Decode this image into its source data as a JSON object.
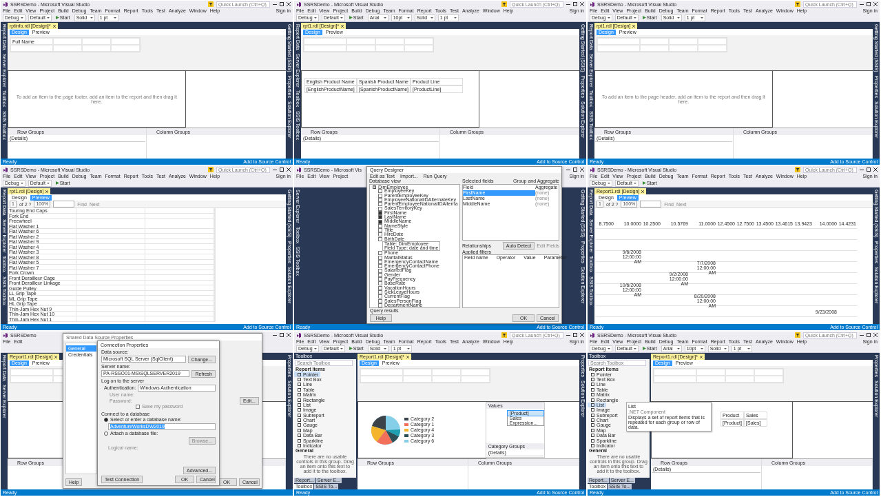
{
  "tiles": [
    {
      "title": "SSRSDemo - Microsoft Visual Studio",
      "quick_launch": {
        "placeholder": "Quick Launch (Ctrl+Q)"
      },
      "sign_in": "Sign in",
      "menu": [
        "File",
        "Edit",
        "View",
        "Project",
        "Build",
        "Debug",
        "Team",
        "Format",
        "Report",
        "Tools",
        "Test",
        "Analyze",
        "Window",
        "Help"
      ],
      "toolbar": [
        {
          "label": "Debug",
          "kind": "combo"
        },
        {
          "label": "Default",
          "kind": "combo"
        },
        {
          "label": "Start",
          "kind": "run"
        },
        {
          "label": "Solid",
          "kind": "combo"
        },
        {
          "label": "1 pt",
          "kind": "combo"
        }
      ],
      "left_tabs": [
        "Report Data",
        "Server Explorer",
        "Toolbox",
        "SSIS Toolbox"
      ],
      "right_tabs": [
        "Getting Started (SSIS)",
        "Properties",
        "Solution Explorer"
      ],
      "document_tab": "rptinfo.rdl [Design]*",
      "view_tabs": [
        {
          "label": "Design",
          "selected": true
        },
        {
          "label": "Preview",
          "selected": false
        }
      ],
      "content": {
        "kind": "design",
        "header_text": "Full Name",
        "body": {
          "kind": "hint",
          "text": "To add an item to the page footer, add an item to the report and then drag it here."
        },
        "groups": {
          "row": "Row Groups",
          "column": "Column Groups",
          "details": "(Details)"
        }
      },
      "status": "Ready",
      "source_control": "Add to Source Control"
    },
    {
      "title": "SSRSDemo - Microsoft Visual Studio",
      "quick_launch": {
        "placeholder": "Quick Launch (Ctrl+Q)"
      },
      "sign_in": "Sign in",
      "menu": [
        "File",
        "Edit",
        "View",
        "Project",
        "Build",
        "Debug",
        "Team",
        "Format",
        "Report",
        "Tools",
        "Test",
        "Analyze",
        "Window",
        "Help"
      ],
      "toolbar": [
        {
          "label": "Debug",
          "kind": "combo"
        },
        {
          "label": "Default",
          "kind": "combo"
        },
        {
          "label": "Start",
          "kind": "run"
        },
        {
          "label": "Arial",
          "kind": "combo"
        },
        {
          "label": "10pt",
          "kind": "combo"
        },
        {
          "label": "Solid",
          "kind": "combo"
        },
        {
          "label": "1 pt",
          "kind": "combo"
        }
      ],
      "left_tabs": [
        "Report Data",
        "Server Explorer",
        "Toolbox",
        "SSIS Toolbox"
      ],
      "right_tabs": [
        "Getting Started (SSIS)",
        "Properties",
        "Solution Explorer"
      ],
      "document_tab": "rpt1.rdl [Design]*",
      "view_tabs": [
        {
          "label": "Design",
          "selected": true
        },
        {
          "label": "Preview",
          "selected": false
        }
      ],
      "content": {
        "kind": "design",
        "body": {
          "kind": "table",
          "columns": [
            "English Product Name",
            "Spanish Product Name",
            "Product Line"
          ],
          "rows": [
            [
              "[EnglishProductName]",
              "[SpanishProductName]",
              "[ProductLine]"
            ]
          ]
        },
        "groups": {
          "row": "Row Groups",
          "column": "Column Groups",
          "details": "(Details)"
        }
      },
      "status": "Ready",
      "source_control": "Add to Source Control"
    },
    {
      "title": "SSRSDemo - Microsoft Visual Studio",
      "quick_launch": {
        "placeholder": "Quick Launch (Ctrl+Q)"
      },
      "sign_in": "Sign in",
      "menu": [
        "File",
        "Edit",
        "View",
        "Project",
        "Build",
        "Debug",
        "Team",
        "Format",
        "Report",
        "Tools",
        "Test",
        "Analyze",
        "Window",
        "Help"
      ],
      "toolbar": [
        {
          "label": "Debug",
          "kind": "combo"
        },
        {
          "label": "Default",
          "kind": "combo"
        },
        {
          "label": "Start",
          "kind": "run"
        },
        {
          "label": "Solid",
          "kind": "combo"
        },
        {
          "label": "1 pt",
          "kind": "combo"
        }
      ],
      "left_tabs": [
        "Report Data",
        "Server Explorer",
        "Toolbox",
        "SSIS Toolbox"
      ],
      "right_tabs": [
        "Getting Started (SSIS)",
        "Properties",
        "Solution Explorer"
      ],
      "document_tab": "rpt1.rdl [Design]",
      "view_tabs": [
        {
          "label": "Design",
          "selected": true
        },
        {
          "label": "Preview",
          "selected": false
        }
      ],
      "content": {
        "kind": "design",
        "body": {
          "kind": "hint",
          "text": "To add an item to the page header, add an item to the report and then drag it here."
        },
        "groups": {
          "row": "Row Groups",
          "column": "Column Groups",
          "details": "(Details)"
        }
      },
      "status": "Ready",
      "source_control": "Add to Source Control"
    },
    {
      "title": "SSRSDemo - Microsoft Visual Studio",
      "quick_launch": {
        "placeholder": "Quick Launch (Ctrl+Q)"
      },
      "sign_in": "Sign in",
      "menu": [
        "File",
        "Edit",
        "View",
        "Project",
        "Build",
        "Debug",
        "Team",
        "Format",
        "Report",
        "Tools",
        "Test",
        "Analyze",
        "Window",
        "Help"
      ],
      "toolbar": [
        {
          "label": "Debug",
          "kind": "combo"
        },
        {
          "label": "Default",
          "kind": "combo"
        },
        {
          "label": "Start",
          "kind": "run"
        }
      ],
      "left_tabs": [
        "Report Data",
        "Server Explorer",
        "Toolbox",
        "SSIS Toolbox"
      ],
      "right_tabs": [
        "Getting Started (SSIS)",
        "Properties",
        "Solution Explorer"
      ],
      "document_tab": "rpt1.rdl [Design]",
      "view_tabs": [
        {
          "label": "Design",
          "selected": false
        },
        {
          "label": "Preview",
          "selected": true
        }
      ],
      "content": {
        "kind": "list",
        "toolbar": {
          "page": "1",
          "of": "of 2 ?",
          "zoom": "100%",
          "find": "Find",
          "next": "Next"
        },
        "rows": [
          "Touring End Caps",
          "Fork End",
          "Freewheel",
          "Flat Washer 1",
          "Flat Washer 6",
          "Flat Washer 2",
          "Flat Washer 9",
          "Flat Washer 4",
          "Flat Washer 3",
          "Flat Washer 8",
          "Flat Washer 5",
          "Flat Washer 7",
          "Fork Crown",
          "Front Derailleur Cage",
          "Front Derailleur Linkage",
          "Guide Pulley",
          "LL Grip Tape",
          "ML Grip Tape",
          "HL Grip Tape",
          "Thin-Jam Hex Nut 9",
          "Thin-Jam Hex Nut 10",
          "Thin-Jam Hex Nut 1"
        ]
      },
      "status": "Ready",
      "source_control": "Add to Source Control"
    },
    {
      "title": "SSRSDemo - Microsoft Vis",
      "sign_in": "Sign in",
      "menu": [
        "File",
        "Edit",
        "View",
        "Project"
      ],
      "left_tabs": [
        "Server Explorer",
        "Toolbox",
        "SSIS Toolbox"
      ],
      "right_tabs": [
        "Getting Started (SSIS)",
        "Properties",
        "Solution Explorer"
      ],
      "content": {
        "kind": "blank"
      },
      "query_designer": {
        "title": "Query Designer",
        "actions": [
          "Edit as Text",
          "Import...",
          "Run Query"
        ],
        "database_view": "Database view",
        "table": "DimEmployee",
        "fields": [
          {
            "label": "EmployeeKey",
            "checked": false
          },
          {
            "label": "ParentEmployeeKey",
            "checked": false
          },
          {
            "label": "EmployeeNationalIDAlternateKey",
            "checked": false
          },
          {
            "label": "ParentEmployeeNationalIDAlterna",
            "checked": false
          },
          {
            "label": "SalesTerritoryKey",
            "checked": false
          },
          {
            "label": "FirstName",
            "checked": true
          },
          {
            "label": "LastName",
            "checked": true
          },
          {
            "label": "MiddleName",
            "checked": true
          },
          {
            "label": "NameStyle",
            "checked": false
          },
          {
            "label": "Title",
            "checked": false
          },
          {
            "label": "HireDate",
            "checked": false
          },
          {
            "label": "BirthDate",
            "checked": false
          },
          {
            "label": "Phone",
            "checked": false
          },
          {
            "label": "MaritalStatus",
            "checked": false
          },
          {
            "label": "EmergencyContactName",
            "checked": false
          },
          {
            "label": "EmergencyContactPhone",
            "checked": false
          },
          {
            "label": "SalariedFlag",
            "checked": false
          },
          {
            "label": "Gender",
            "checked": false
          },
          {
            "label": "PayFrequency",
            "checked": false
          },
          {
            "label": "BaseRate",
            "checked": false
          },
          {
            "label": "VacationHours",
            "checked": false
          },
          {
            "label": "SickLeaveHours",
            "checked": false
          },
          {
            "label": "CurrentFlag",
            "checked": false
          },
          {
            "label": "SalesPersonFlag",
            "checked": false
          },
          {
            "label": "DepartmentName",
            "checked": false
          }
        ],
        "tooltip": [
          "Table: DimEmployee",
          "Field Type: date and time"
        ],
        "selected_fields": "Selected fields",
        "group_aggregate": "Group and Aggregate",
        "field_columns": [
          "Field",
          "Aggregate"
        ],
        "selected": [
          {
            "field": "FirstName",
            "aggregate": "(none)",
            "selected": true
          },
          {
            "field": "LastName",
            "aggregate": "(none)",
            "selected": false
          },
          {
            "field": "MiddleName",
            "aggregate": "(none)",
            "selected": false
          }
        ],
        "relationships": "Relationships",
        "auto_detect": "Auto Detect",
        "edit_fields": "Edit Fields",
        "applied_filters": "Applied filters",
        "filter_columns": [
          "Field name",
          "Operator",
          "Value",
          "Parameter"
        ],
        "query_results": "Query results",
        "buttons": [
          "Help",
          "OK",
          "Cancel"
        ]
      },
      "status": "Ready",
      "source_control": "Add to Source Control"
    },
    {
      "title": "SSRSDemo - Microsoft Visual Studio",
      "quick_launch": {
        "placeholder": "Quick Launch (Ctrl+Q)"
      },
      "sign_in": "Sign in",
      "menu": [
        "File",
        "Edit",
        "View",
        "Project",
        "Build",
        "Debug",
        "Team",
        "Format",
        "Report",
        "Tools",
        "Test",
        "Analyze",
        "Window",
        "Help"
      ],
      "toolbar": [
        {
          "label": "Debug",
          "kind": "combo"
        },
        {
          "label": "Default",
          "kind": "combo"
        },
        {
          "label": "Start",
          "kind": "run"
        }
      ],
      "left_tabs": [
        "Report Data",
        "Server Explorer",
        "Toolbox",
        "SSIS Toolbox"
      ],
      "right_tabs": [
        "Getting Started (SSIS)",
        "Properties",
        "Solution Explorer"
      ],
      "document_tab": "Report1.rdl [Design]",
      "view_tabs": [
        {
          "label": "Design",
          "selected": false
        },
        {
          "label": "Preview",
          "selected": true
        }
      ],
      "content": {
        "kind": "matrix",
        "toolbar": {
          "page": "1",
          "of": "of 2 ?",
          "zoom": "100%",
          "find": "Find",
          "next": "Next"
        },
        "columns": [
          "8.7500",
          "10.0000",
          "10.2500",
          "10.5769",
          "11.0000",
          "12.4500",
          "12.7500",
          "13.4500",
          "13.4615",
          "13.9423",
          "14.0000",
          "14.4231"
        ],
        "rows": [
          [
            null,
            null,
            null,
            null,
            null,
            null,
            null,
            null,
            null,
            null,
            null,
            null
          ],
          [
            null,
            null,
            null,
            null,
            null,
            null,
            null,
            null,
            null,
            null,
            null,
            null
          ],
          [
            null,
            "9/6/2008 12:00:00 AM",
            null,
            null,
            null,
            null,
            null,
            null,
            null,
            null,
            null,
            null
          ],
          [
            null,
            null,
            null,
            null,
            "7/7/2008 12:00:00 AM",
            null,
            null,
            null,
            null,
            null,
            null,
            null
          ],
          [
            null,
            null,
            null,
            "9/2/2008 12:00:00 AM",
            null,
            null,
            null,
            null,
            null,
            null,
            null,
            null
          ],
          [
            null,
            "10/6/2008 12:00:00 AM",
            null,
            null,
            null,
            null,
            null,
            null,
            null,
            null,
            null,
            null
          ],
          [
            null,
            null,
            null,
            null,
            "8/20/2008 12:00:00 AM",
            null,
            null,
            null,
            null,
            null,
            null,
            null
          ],
          [
            null,
            null,
            null,
            null,
            null,
            null,
            null,
            null,
            null,
            null,
            "9/23/2008",
            null
          ]
        ]
      },
      "status": "Ready",
      "source_control": "Add to Source Control"
    },
    {
      "title": "SSRSDemo",
      "menu": [
        "File",
        "Edit"
      ],
      "left_tabs": [
        "Report Data",
        "Server Explorer"
      ],
      "right_tabs": [
        "Properties",
        "Solution Explorer"
      ],
      "document_tab": "Report1.rdl [Design]",
      "view_tabs": [
        {
          "label": "Design",
          "selected": true
        },
        {
          "label": "Preview",
          "selected": false
        }
      ],
      "content": {
        "kind": "design",
        "body": {
          "kind": "none"
        },
        "groups": {
          "row": "Row Groups"
        }
      },
      "connection": {
        "behind": {
          "title": "Shared Data Source Properties",
          "nav": [
            {
              "label": "General",
              "selected": true
            },
            {
              "label": "Credentials",
              "selected": false
            }
          ],
          "help": "Help",
          "edit": "Edit...",
          "ok": "OK",
          "cancel": "Cancel"
        },
        "title": "Connection Properties",
        "data_source_label": "Data source:",
        "data_source": "Microsoft SQL Server (SqlClient)",
        "change": "Change...",
        "server_label": "Server name:",
        "server": "PA-RSSO01-MS\\SQLSERVER2019",
        "refresh": "Refresh",
        "logon": "Log on to the server",
        "auth_label": "Authentication:",
        "auth": "Windows Authentication",
        "user_label": "User name:",
        "password_label": "Password:",
        "save_password": {
          "label": "Save my password",
          "checked": false
        },
        "connect": "Connect to a database",
        "options": [
          {
            "label": "Select or enter a database name:",
            "selected": true
          },
          {
            "label": "Attach a database file:",
            "selected": false
          }
        ],
        "database": "AdventureWorksDW2019",
        "browse": "Browse...",
        "logical": "Logical name:",
        "advanced": "Advanced...",
        "test": "Test Connection",
        "ok": "OK",
        "cancel": "Cancel"
      },
      "status": "Ready"
    },
    {
      "title": "SSRSDemo - Microsoft Visual Studio",
      "quick_launch": {
        "placeholder": "Quick Launch (Ctrl+Q)"
      },
      "sign_in": "Sign in",
      "menu": [
        "File",
        "Edit",
        "View",
        "Project",
        "Build",
        "Debug",
        "Team",
        "Format",
        "Report",
        "Tools",
        "Test",
        "Analyze",
        "Window",
        "Help"
      ],
      "toolbar": [
        {
          "label": "Debug",
          "kind": "combo"
        },
        {
          "label": "Default",
          "kind": "combo"
        },
        {
          "label": "Start",
          "kind": "run"
        },
        {
          "label": "Solid",
          "kind": "combo"
        },
        {
          "label": "1 pt",
          "kind": "combo"
        }
      ],
      "toolbox": {
        "title": "Toolbox",
        "search": {
          "placeholder": "Search Toolbox"
        },
        "group": "Report Items",
        "items": [
          {
            "label": "Pointer",
            "selected": true
          },
          {
            "label": "Text Box",
            "selected": false
          },
          {
            "label": "Line",
            "selected": false
          },
          {
            "label": "Table",
            "selected": false
          },
          {
            "label": "Matrix",
            "selected": false
          },
          {
            "label": "Rectangle",
            "selected": false
          },
          {
            "label": "List",
            "selected": false
          },
          {
            "label": "Image",
            "selected": false
          },
          {
            "label": "Subreport",
            "selected": false
          },
          {
            "label": "Chart",
            "selected": false
          },
          {
            "label": "Gauge",
            "selected": false
          },
          {
            "label": "Map",
            "selected": false
          },
          {
            "label": "Data Bar",
            "selected": false
          },
          {
            "label": "Sparkline",
            "selected": false
          },
          {
            "label": "Indicator",
            "selected": false
          }
        ],
        "general": "General",
        "empty": "There are no usable controls in this group. Drag an item onto this text to add it to the toolbox.",
        "bottom_tabs": [
          {
            "label": "Report...",
            "selected": false
          },
          {
            "label": "Server E...",
            "selected": false
          },
          {
            "label": "Toolbox",
            "selected": true
          },
          {
            "label": "SSIS To...",
            "selected": false
          }
        ]
      },
      "right_tabs": [
        "Properties",
        "Solution Explorer"
      ],
      "document_tab": "Report1.rdl [Design]*",
      "view_tabs": [
        {
          "label": "Design",
          "selected": true
        },
        {
          "label": "Preview",
          "selected": false
        }
      ],
      "content": {
        "kind": "design",
        "body": {
          "kind": "chart",
          "legend": [
            {
              "label": "Category 2",
              "color": "#3d4449"
            },
            {
              "label": "Category 1",
              "color": "#f2705a"
            },
            {
              "label": "Category 4",
              "color": "#f4b42c"
            },
            {
              "label": "Category 3",
              "color": "#2d4f55"
            },
            {
              "label": "Category 6",
              "color": "#86cfe8"
            }
          ],
          "values_title": "Values",
          "menu": [
            {
              "label": "[Product]",
              "selected": true
            },
            {
              "label": "Sales",
              "selected": false
            },
            {
              "label": "Expression...",
              "selected": false
            }
          ],
          "category_groups": "Category Groups",
          "category_details": "(Details)"
        },
        "groups": {
          "row": "Row Groups",
          "column": "Column Groups"
        }
      },
      "status": "Ready",
      "source_control": "Add to Source Control"
    },
    {
      "title": "SSRSDemo - Microsoft Visual Studio",
      "quick_launch": {
        "placeholder": "Quick Launch (Ctrl+Q)"
      },
      "sign_in": "Sign in",
      "menu": [
        "File",
        "Edit",
        "View",
        "Project",
        "Build",
        "Debug",
        "Team",
        "Format",
        "Report",
        "Tools",
        "Test",
        "Analyze",
        "Window",
        "Help"
      ],
      "toolbar": [
        {
          "label": "Debug",
          "kind": "combo"
        },
        {
          "label": "Default",
          "kind": "combo"
        },
        {
          "label": "Start",
          "kind": "run"
        },
        {
          "label": "Arial",
          "kind": "combo"
        },
        {
          "label": "10pt",
          "kind": "combo"
        },
        {
          "label": "Solid",
          "kind": "combo"
        },
        {
          "label": "1 pt",
          "kind": "combo"
        }
      ],
      "toolbox": {
        "title": "Toolbox",
        "search": {
          "placeholder": "Search Toolbox"
        },
        "group": "Report Items",
        "items": [
          {
            "label": "Pointer",
            "selected": false
          },
          {
            "label": "Text Box",
            "selected": false
          },
          {
            "label": "Line",
            "selected": false
          },
          {
            "label": "Table",
            "selected": false
          },
          {
            "label": "Matrix",
            "selected": false
          },
          {
            "label": "Rectangle",
            "selected": false
          },
          {
            "label": "List",
            "selected": true
          },
          {
            "label": "Image",
            "selected": false
          },
          {
            "label": "Subreport",
            "selected": false
          },
          {
            "label": "Chart",
            "selected": false
          },
          {
            "label": "Gauge",
            "selected": false
          },
          {
            "label": "Map",
            "selected": false
          },
          {
            "label": "Data Bar",
            "selected": false
          },
          {
            "label": "Sparkline",
            "selected": false
          },
          {
            "label": "Indicator",
            "selected": false
          }
        ],
        "general": "General",
        "empty": "There are no usable controls in this group. Drag an item onto this text to add it to the toolbox.",
        "bottom_tabs": [
          {
            "label": "Report...",
            "selected": false
          },
          {
            "label": "Server E...",
            "selected": false
          },
          {
            "label": "Toolbox",
            "selected": true
          },
          {
            "label": "SSIS To...",
            "selected": false
          }
        ],
        "tooltip": [
          "List",
          ".NET Component",
          "Displays a set of report items that is repeated for each group or row of data."
        ]
      },
      "right_tabs": [
        "Properties",
        "Solution Explorer"
      ],
      "document_tab": "Report1.rdl [Design]*",
      "view_tabs": [
        {
          "label": "Design",
          "selected": true
        },
        {
          "label": "Preview",
          "selected": false
        }
      ],
      "content": {
        "kind": "design",
        "body": {
          "kind": "small_table",
          "columns": [
            "Product",
            "Sales"
          ],
          "rows": [
            [
              "[Product]",
              "[Sales]"
            ]
          ]
        },
        "groups": {
          "row": "Row Groups",
          "column": "Column Groups",
          "details": "(Details)"
        }
      },
      "status": "Ready",
      "source_control": "Add to Source Control"
    }
  ]
}
